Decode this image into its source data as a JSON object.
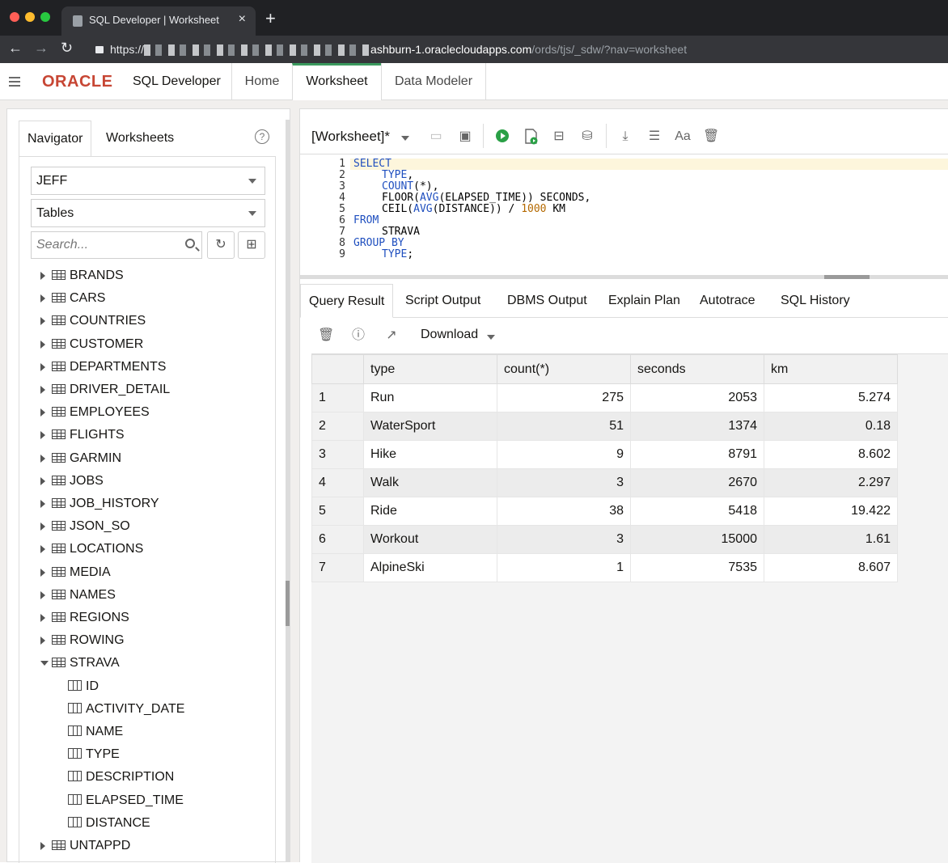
{
  "browser": {
    "tab_title": "SQL Developer | Worksheet",
    "tab_close": "×",
    "new_tab": "+",
    "url_scheme": "https://",
    "url_host": "ashburn-1.oraclecloudapps.com",
    "url_path": "/ords/tjs/_sdw/?nav=worksheet"
  },
  "app": {
    "brand": "ORACLE",
    "product": "SQL Developer",
    "tabs": [
      "Home",
      "Worksheet",
      "Data Modeler"
    ],
    "active_tab": "Worksheet"
  },
  "navigator": {
    "tabs": [
      "Navigator",
      "Worksheets"
    ],
    "schema": "JEFF",
    "object_type": "Tables",
    "search_placeholder": "Search...",
    "tables": [
      "BRANDS",
      "CARS",
      "COUNTRIES",
      "CUSTOMER",
      "DEPARTMENTS",
      "DRIVER_DETAIL",
      "EMPLOYEES",
      "FLIGHTS",
      "GARMIN",
      "JOBS",
      "JOB_HISTORY",
      "JSON_SO",
      "LOCATIONS",
      "MEDIA",
      "NAMES",
      "REGIONS",
      "ROWING",
      "STRAVA"
    ],
    "expanded_table": "STRAVA",
    "columns": [
      "ID",
      "ACTIVITY_DATE",
      "NAME",
      "TYPE",
      "DESCRIPTION",
      "ELAPSED_TIME",
      "DISTANCE"
    ],
    "after_tables": [
      "UNTAPPD"
    ]
  },
  "worksheet": {
    "name": "[Worksheet]*",
    "line_numbers": [
      "1",
      "2",
      "3",
      "4",
      "5",
      "6",
      "7",
      "8",
      "9"
    ]
  },
  "results": {
    "tabs": [
      "Query Result",
      "Script Output",
      "DBMS Output",
      "Explain Plan",
      "Autotrace",
      "SQL History"
    ],
    "active_tab": "Query Result",
    "download_label": "Download",
    "columns": [
      "type",
      "count(*)",
      "seconds",
      "km"
    ],
    "rows": [
      {
        "n": "1",
        "type": "Run",
        "count": "275",
        "seconds": "2053",
        "km": "5.274"
      },
      {
        "n": "2",
        "type": "WaterSport",
        "count": "51",
        "seconds": "1374",
        "km": "0.18"
      },
      {
        "n": "3",
        "type": "Hike",
        "count": "9",
        "seconds": "8791",
        "km": "8.602"
      },
      {
        "n": "4",
        "type": "Walk",
        "count": "3",
        "seconds": "2670",
        "km": "2.297"
      },
      {
        "n": "5",
        "type": "Ride",
        "count": "38",
        "seconds": "5418",
        "km": "19.422"
      },
      {
        "n": "6",
        "type": "Workout",
        "count": "3",
        "seconds": "15000",
        "km": "1.61"
      },
      {
        "n": "7",
        "type": "AlpineSki",
        "count": "1",
        "seconds": "7535",
        "km": "8.607"
      }
    ]
  },
  "sql": {
    "l1_kw": "SELECT",
    "l2_kw": "TYPE",
    "l2_rest": ",",
    "l3_kw": "COUNT",
    "l3_rest": "(*),",
    "l4_a": "FLOOR(",
    "l4_kw": "AVG",
    "l4_b": "(ELAPSED_TIME)) SECONDS,",
    "l5_a": "CEIL(",
    "l5_kw": "AVG",
    "l5_b": "(DISTANCE)) / ",
    "l5_num": "1000",
    "l5_c": " KM",
    "l6_kw": "FROM",
    "l7": "STRAVA",
    "l8_kw": "GROUP BY",
    "l9_kw": "TYPE",
    "l9_rest": ";"
  },
  "colors": {
    "oracle_red": "#c74634",
    "active_tab_accent": "#3b9a5e",
    "run_green": "#2aa046",
    "keyword_blue": "#1f4fbf",
    "number_orange": "#b46900"
  }
}
